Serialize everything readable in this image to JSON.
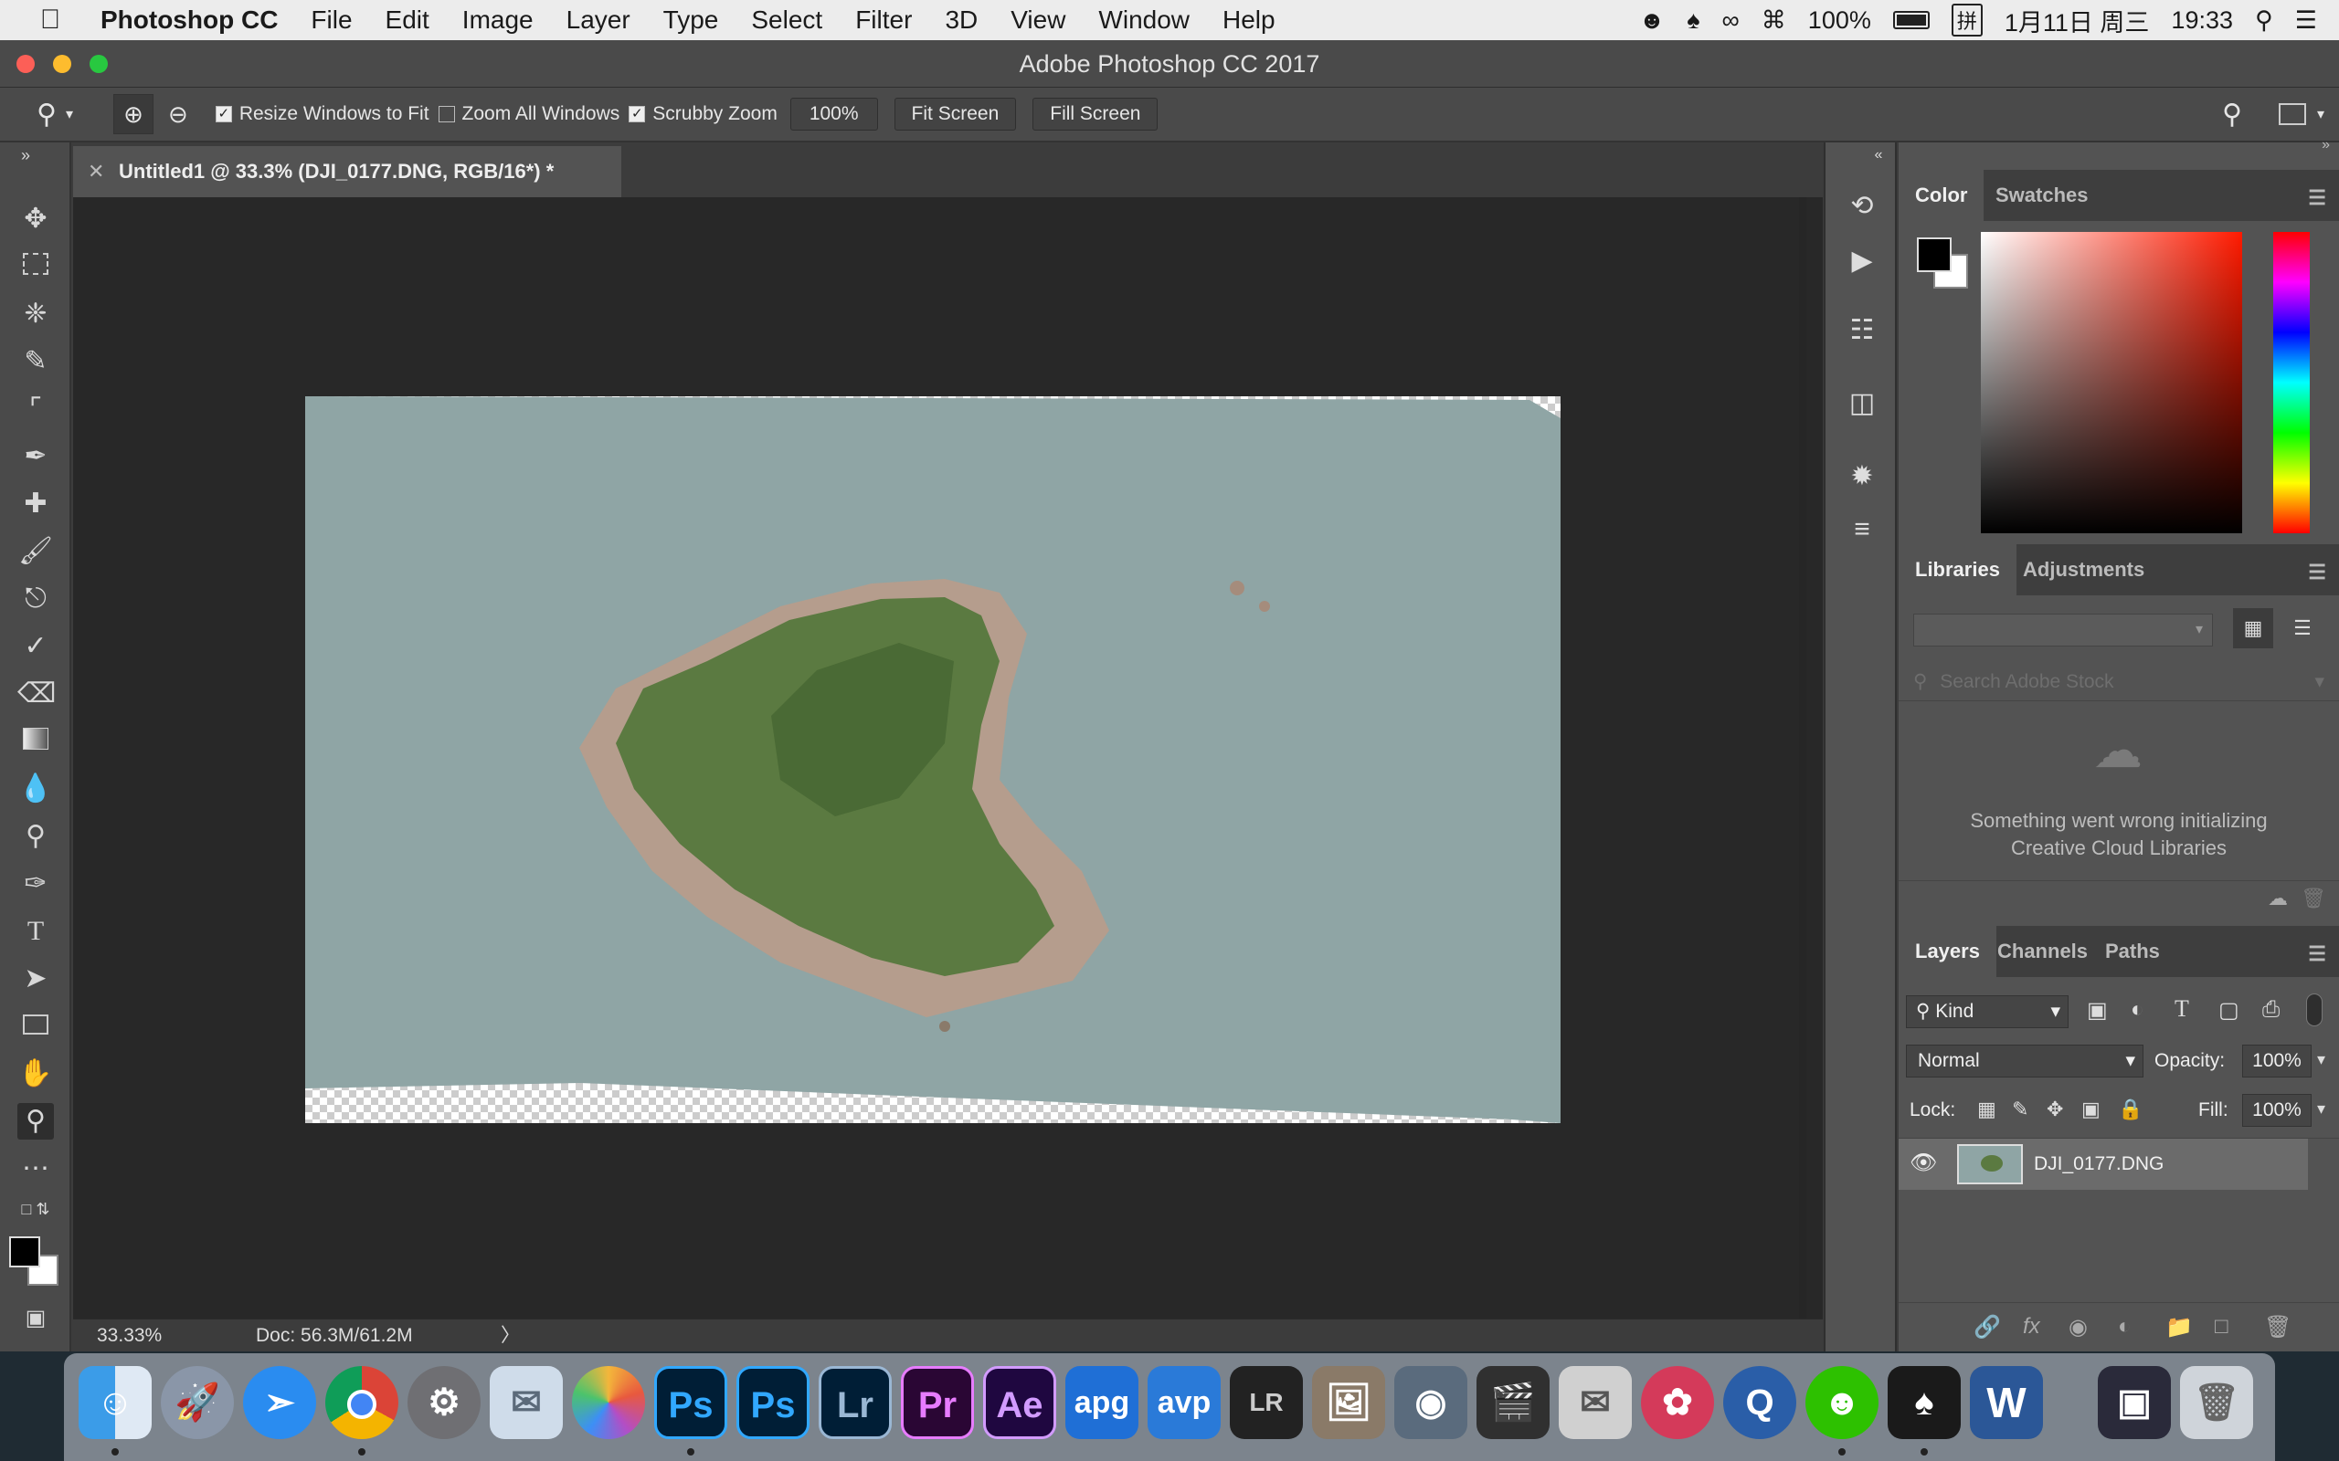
{
  "menubar": {
    "apple": "",
    "app_name": "Photoshop CC",
    "items": [
      "File",
      "Edit",
      "Image",
      "Layer",
      "Type",
      "Select",
      "Filter",
      "3D",
      "View",
      "Window",
      "Help"
    ],
    "battery": "100%",
    "input_method": "拼",
    "date": "1月11日 周三",
    "time": "19:33"
  },
  "window": {
    "title": "Adobe Photoshop CC 2017"
  },
  "options": {
    "resize_windows": "Resize Windows to Fit",
    "zoom_all": "Zoom All Windows",
    "scrubby_zoom": "Scrubby Zoom",
    "zoom_value": "100%",
    "fit_screen": "Fit Screen",
    "fill_screen": "Fill Screen"
  },
  "document": {
    "tab_title": "Untitled1 @ 33.3% (DJI_0177.DNG, RGB/16*) *",
    "zoom": "33.33%",
    "doc_size": "Doc: 56.3M/61.2M"
  },
  "color_panel": {
    "tabs": [
      "Color",
      "Swatches"
    ]
  },
  "libraries_panel": {
    "tabs": [
      "Libraries",
      "Adjustments"
    ],
    "search_placeholder": "Search Adobe Stock",
    "error_line1": "Something went wrong initializing",
    "error_line2": "Creative Cloud Libraries"
  },
  "layers_panel": {
    "tabs": [
      "Layers",
      "Channels",
      "Paths"
    ],
    "filter_kind": "Kind",
    "blend_mode": "Normal",
    "opacity_label": "Opacity:",
    "opacity_value": "100%",
    "lock_label": "Lock:",
    "fill_label": "Fill:",
    "fill_value": "100%",
    "layers": [
      {
        "name": "DJI_0177.DNG",
        "visible": true
      }
    ]
  },
  "dock": {
    "apps": [
      "Finder",
      "Launchpad",
      "Safari",
      "Chrome",
      "System Preferences",
      "Preview",
      "Photos",
      "Ps",
      "Ps",
      "Lr",
      "Pr",
      "Ae",
      "apg",
      "avp",
      "LRTimelapse",
      "Image Capture",
      "Motion",
      "Final Cut Pro",
      "Proxy",
      "DaVinci Resolve",
      "QuickTime",
      "WeChat",
      "QQ",
      "Word",
      "Screenshot",
      "Trash"
    ]
  }
}
